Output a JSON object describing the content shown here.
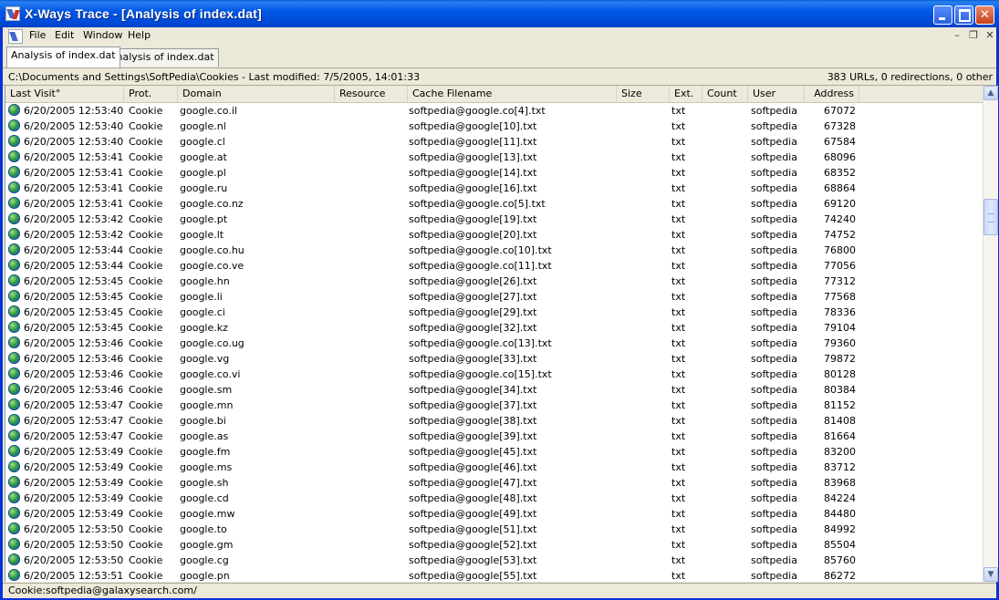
{
  "window": {
    "title": "X-Ways Trace - [Analysis of index.dat]"
  },
  "menu": {
    "items": [
      "File",
      "Edit",
      "Window",
      "Help"
    ]
  },
  "tabs": [
    {
      "label": "Analysis of index.dat",
      "active": true
    },
    {
      "label": "Analysis of index.dat",
      "active": false
    }
  ],
  "pathbar": {
    "path": "C:\\Documents and Settings\\SoftPedia\\Cookies - Last modified: 7/5/2005, 14:01:33",
    "stats": "383 URLs, 0 redirections, 0 other"
  },
  "table": {
    "columns": [
      "Last Visit°",
      "Prot.",
      "Domain",
      "Resource",
      "Cache Filename",
      "Size",
      "Ext.",
      "Count",
      "User",
      "Address"
    ],
    "rows": [
      [
        "6/20/2005 12:53:40",
        "Cookie",
        "google.co.il",
        "",
        "softpedia@google.co[4].txt",
        "",
        "txt",
        "",
        "softpedia",
        "67072"
      ],
      [
        "6/20/2005 12:53:40",
        "Cookie",
        "google.nl",
        "",
        "softpedia@google[10].txt",
        "",
        "txt",
        "",
        "softpedia",
        "67328"
      ],
      [
        "6/20/2005 12:53:40",
        "Cookie",
        "google.cl",
        "",
        "softpedia@google[11].txt",
        "",
        "txt",
        "",
        "softpedia",
        "67584"
      ],
      [
        "6/20/2005 12:53:41",
        "Cookie",
        "google.at",
        "",
        "softpedia@google[13].txt",
        "",
        "txt",
        "",
        "softpedia",
        "68096"
      ],
      [
        "6/20/2005 12:53:41",
        "Cookie",
        "google.pl",
        "",
        "softpedia@google[14].txt",
        "",
        "txt",
        "",
        "softpedia",
        "68352"
      ],
      [
        "6/20/2005 12:53:41",
        "Cookie",
        "google.ru",
        "",
        "softpedia@google[16].txt",
        "",
        "txt",
        "",
        "softpedia",
        "68864"
      ],
      [
        "6/20/2005 12:53:41",
        "Cookie",
        "google.co.nz",
        "",
        "softpedia@google.co[5].txt",
        "",
        "txt",
        "",
        "softpedia",
        "69120"
      ],
      [
        "6/20/2005 12:53:42",
        "Cookie",
        "google.pt",
        "",
        "softpedia@google[19].txt",
        "",
        "txt",
        "",
        "softpedia",
        "74240"
      ],
      [
        "6/20/2005 12:53:42",
        "Cookie",
        "google.lt",
        "",
        "softpedia@google[20].txt",
        "",
        "txt",
        "",
        "softpedia",
        "74752"
      ],
      [
        "6/20/2005 12:53:44",
        "Cookie",
        "google.co.hu",
        "",
        "softpedia@google.co[10].txt",
        "",
        "txt",
        "",
        "softpedia",
        "76800"
      ],
      [
        "6/20/2005 12:53:44",
        "Cookie",
        "google.co.ve",
        "",
        "softpedia@google.co[11].txt",
        "",
        "txt",
        "",
        "softpedia",
        "77056"
      ],
      [
        "6/20/2005 12:53:45",
        "Cookie",
        "google.hn",
        "",
        "softpedia@google[26].txt",
        "",
        "txt",
        "",
        "softpedia",
        "77312"
      ],
      [
        "6/20/2005 12:53:45",
        "Cookie",
        "google.li",
        "",
        "softpedia@google[27].txt",
        "",
        "txt",
        "",
        "softpedia",
        "77568"
      ],
      [
        "6/20/2005 12:53:45",
        "Cookie",
        "google.ci",
        "",
        "softpedia@google[29].txt",
        "",
        "txt",
        "",
        "softpedia",
        "78336"
      ],
      [
        "6/20/2005 12:53:45",
        "Cookie",
        "google.kz",
        "",
        "softpedia@google[32].txt",
        "",
        "txt",
        "",
        "softpedia",
        "79104"
      ],
      [
        "6/20/2005 12:53:46",
        "Cookie",
        "google.co.ug",
        "",
        "softpedia@google.co[13].txt",
        "",
        "txt",
        "",
        "softpedia",
        "79360"
      ],
      [
        "6/20/2005 12:53:46",
        "Cookie",
        "google.vg",
        "",
        "softpedia@google[33].txt",
        "",
        "txt",
        "",
        "softpedia",
        "79872"
      ],
      [
        "6/20/2005 12:53:46",
        "Cookie",
        "google.co.vi",
        "",
        "softpedia@google.co[15].txt",
        "",
        "txt",
        "",
        "softpedia",
        "80128"
      ],
      [
        "6/20/2005 12:53:46",
        "Cookie",
        "google.sm",
        "",
        "softpedia@google[34].txt",
        "",
        "txt",
        "",
        "softpedia",
        "80384"
      ],
      [
        "6/20/2005 12:53:47",
        "Cookie",
        "google.mn",
        "",
        "softpedia@google[37].txt",
        "",
        "txt",
        "",
        "softpedia",
        "81152"
      ],
      [
        "6/20/2005 12:53:47",
        "Cookie",
        "google.bi",
        "",
        "softpedia@google[38].txt",
        "",
        "txt",
        "",
        "softpedia",
        "81408"
      ],
      [
        "6/20/2005 12:53:47",
        "Cookie",
        "google.as",
        "",
        "softpedia@google[39].txt",
        "",
        "txt",
        "",
        "softpedia",
        "81664"
      ],
      [
        "6/20/2005 12:53:49",
        "Cookie",
        "google.fm",
        "",
        "softpedia@google[45].txt",
        "",
        "txt",
        "",
        "softpedia",
        "83200"
      ],
      [
        "6/20/2005 12:53:49",
        "Cookie",
        "google.ms",
        "",
        "softpedia@google[46].txt",
        "",
        "txt",
        "",
        "softpedia",
        "83712"
      ],
      [
        "6/20/2005 12:53:49",
        "Cookie",
        "google.sh",
        "",
        "softpedia@google[47].txt",
        "",
        "txt",
        "",
        "softpedia",
        "83968"
      ],
      [
        "6/20/2005 12:53:49",
        "Cookie",
        "google.cd",
        "",
        "softpedia@google[48].txt",
        "",
        "txt",
        "",
        "softpedia",
        "84224"
      ],
      [
        "6/20/2005 12:53:49",
        "Cookie",
        "google.mw",
        "",
        "softpedia@google[49].txt",
        "",
        "txt",
        "",
        "softpedia",
        "84480"
      ],
      [
        "6/20/2005 12:53:50",
        "Cookie",
        "google.to",
        "",
        "softpedia@google[51].txt",
        "",
        "txt",
        "",
        "softpedia",
        "84992"
      ],
      [
        "6/20/2005 12:53:50",
        "Cookie",
        "google.gm",
        "",
        "softpedia@google[52].txt",
        "",
        "txt",
        "",
        "softpedia",
        "85504"
      ],
      [
        "6/20/2005 12:53:50",
        "Cookie",
        "google.cg",
        "",
        "softpedia@google[53].txt",
        "",
        "txt",
        "",
        "softpedia",
        "85760"
      ],
      [
        "6/20/2005 12:53:51",
        "Cookie",
        "google.pn",
        "",
        "softpedia@google[55].txt",
        "",
        "txt",
        "",
        "softpedia",
        "86272"
      ]
    ]
  },
  "statusbar": {
    "text": "Cookie:softpedia@galaxysearch.com/"
  }
}
